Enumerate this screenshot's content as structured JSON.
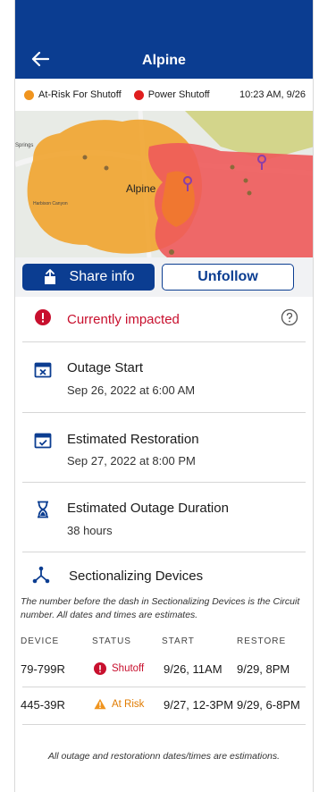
{
  "header": {
    "title": "Alpine"
  },
  "legend": {
    "at_risk_label": "At-Risk For Shutoff",
    "power_shutoff_label": "Power Shutoff",
    "timestamp": "10:23 AM, 9/26",
    "at_risk_color": "#f0941e",
    "shutoff_color": "#e01e1e"
  },
  "map": {
    "place_label": "Alpine",
    "small_labels": [
      "Springs",
      "Harbison Canyon"
    ]
  },
  "actions": {
    "share_label": "Share info",
    "unfollow_label": "Unfollow"
  },
  "impact": {
    "text": "Currently impacted"
  },
  "outage_start": {
    "title": "Outage Start",
    "value": "Sep 26, 2022 at 6:00 AM"
  },
  "restoration": {
    "title": "Estimated Restoration",
    "value": "Sep 27, 2022 at 8:00 PM"
  },
  "duration": {
    "title": "Estimated Outage Duration",
    "value": "38 hours"
  },
  "sectionalizing": {
    "title": "Sectionalizing Devices",
    "note": "The number before the dash in Sectionalizing Devices is the Circuit number. All dates and times are estimates.",
    "columns": [
      "DEVICE",
      "STATUS",
      "START",
      "RESTORE"
    ],
    "rows": [
      {
        "device": "79-799R",
        "status": "Shutoff",
        "start": "9/26, 11AM",
        "restore": "9/29, 8PM"
      },
      {
        "device": "445-39R",
        "status": "At Risk",
        "start": "9/27, 12-3PM",
        "restore": "9/29, 6-8PM"
      }
    ]
  },
  "footer": {
    "note": "All outage and restorationn dates/times are estimations."
  }
}
